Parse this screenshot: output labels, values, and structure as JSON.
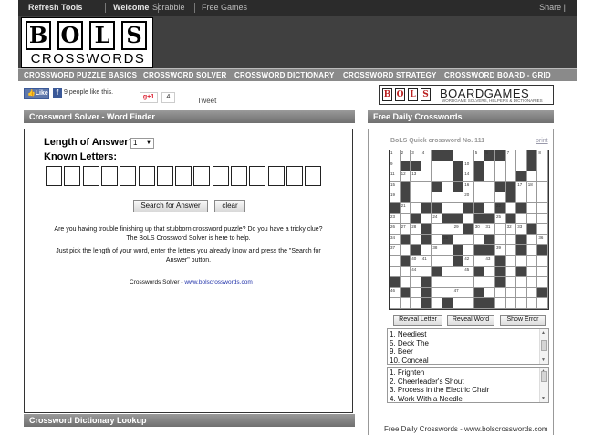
{
  "topnav": {
    "items": [
      "Refresh Tools",
      "Welcome",
      "Scrabble",
      "Free Games"
    ],
    "share": "Share |"
  },
  "logo": {
    "letters": [
      "B",
      "O",
      "L",
      "S"
    ],
    "word": "CROSSWORDS"
  },
  "menu": [
    "CROSSWORD PUZZLE BASICS",
    "CROSSWORD SOLVER",
    "CROSSWORD DICTIONARY",
    "CROSSWORD STRATEGY",
    "CROSSWORD BOARD - GRID"
  ],
  "social": {
    "like_label": "Like",
    "like_text": "9 people like this.",
    "gplus_label": "+1",
    "gplus_count": "4",
    "tweet_label": "Tweet"
  },
  "banner": {
    "letters": [
      "B",
      "O",
      "L",
      "S"
    ],
    "name": "BOARDGAMES",
    "tagline": "WORDGAME SOLVERS, HELPERS & DICTIONARIES"
  },
  "solver": {
    "header": "Crossword Solver - Word Finder",
    "length_label": "Length of Answer?",
    "length_value": "1",
    "known_label": "Known Letters:",
    "letter_box_count": 15,
    "search_button": "Search for Answer",
    "clear_button": "clear",
    "para1_line1": "Are you having trouble finishing up that stubborn crossword puzzle? Do you have a tricky clue?",
    "para1_line2": "The BoLS Crossword Solver is here to help.",
    "para2_line1": "Just pick the length of your word, enter the letters you already know and press the \"Search for",
    "para2_line2": "Answer\" button.",
    "credit_text": "Crosswords Solver - ",
    "credit_link": "www.bolscrosswords.com"
  },
  "dictionary": {
    "header": "Crossword Dictionary Lookup"
  },
  "daily": {
    "header": "Free Daily Crosswords",
    "title": "BoLS Quick crossword No. 111",
    "print": "print",
    "grid_size": 15,
    "black_cells": [
      [
        0,
        4
      ],
      [
        0,
        5
      ],
      [
        0,
        9
      ],
      [
        0,
        10
      ],
      [
        0,
        13
      ],
      [
        1,
        1
      ],
      [
        1,
        2
      ],
      [
        1,
        6
      ],
      [
        1,
        8
      ],
      [
        1,
        13
      ],
      [
        2,
        6
      ],
      [
        2,
        8
      ],
      [
        2,
        12
      ],
      [
        3,
        1
      ],
      [
        3,
        4
      ],
      [
        3,
        6
      ],
      [
        3,
        10
      ],
      [
        3,
        11
      ],
      [
        4,
        1
      ],
      [
        4,
        11
      ],
      [
        5,
        0
      ],
      [
        5,
        3
      ],
      [
        5,
        4
      ],
      [
        5,
        7
      ],
      [
        5,
        8
      ],
      [
        5,
        10
      ],
      [
        5,
        12
      ],
      [
        6,
        2
      ],
      [
        6,
        5
      ],
      [
        6,
        6
      ],
      [
        6,
        8
      ],
      [
        6,
        9
      ],
      [
        6,
        11
      ],
      [
        7,
        3
      ],
      [
        7,
        7
      ],
      [
        7,
        13
      ],
      [
        8,
        1
      ],
      [
        8,
        3
      ],
      [
        8,
        5
      ],
      [
        8,
        9
      ],
      [
        8,
        12
      ],
      [
        9,
        2
      ],
      [
        9,
        6
      ],
      [
        9,
        8
      ],
      [
        9,
        9
      ],
      [
        9,
        12
      ],
      [
        9,
        14
      ],
      [
        10,
        1
      ],
      [
        10,
        6
      ],
      [
        10,
        10
      ],
      [
        11,
        4
      ],
      [
        11,
        8
      ],
      [
        11,
        10
      ],
      [
        11,
        12
      ],
      [
        12,
        0
      ],
      [
        12,
        3
      ],
      [
        12,
        10
      ],
      [
        13,
        1
      ],
      [
        13,
        3
      ],
      [
        13,
        8
      ],
      [
        13,
        14
      ],
      [
        14,
        3
      ],
      [
        14,
        5
      ],
      [
        14,
        8
      ],
      [
        14,
        9
      ]
    ],
    "numbered_cells": [
      [
        0,
        0,
        "1"
      ],
      [
        0,
        1,
        "2"
      ],
      [
        0,
        2,
        "3"
      ],
      [
        0,
        3,
        "4"
      ],
      [
        0,
        8,
        "5"
      ],
      [
        0,
        9,
        "6"
      ],
      [
        0,
        11,
        "7"
      ],
      [
        0,
        14,
        "8"
      ],
      [
        1,
        0,
        "9"
      ],
      [
        1,
        7,
        "10"
      ],
      [
        2,
        0,
        "11"
      ],
      [
        2,
        1,
        "12"
      ],
      [
        2,
        2,
        "13"
      ],
      [
        2,
        7,
        "14"
      ],
      [
        3,
        0,
        "15"
      ],
      [
        3,
        7,
        "16"
      ],
      [
        3,
        12,
        "17"
      ],
      [
        3,
        13,
        "18"
      ],
      [
        4,
        0,
        "19"
      ],
      [
        4,
        7,
        "20"
      ],
      [
        5,
        1,
        "21"
      ],
      [
        5,
        10,
        "22"
      ],
      [
        6,
        0,
        "23"
      ],
      [
        6,
        4,
        "24"
      ],
      [
        6,
        10,
        "25"
      ],
      [
        7,
        0,
        "26"
      ],
      [
        7,
        1,
        "27"
      ],
      [
        7,
        2,
        "28"
      ],
      [
        7,
        6,
        "29"
      ],
      [
        7,
        8,
        "30"
      ],
      [
        7,
        9,
        "31"
      ],
      [
        7,
        11,
        "32"
      ],
      [
        7,
        12,
        "33"
      ],
      [
        8,
        0,
        "34"
      ],
      [
        8,
        5,
        "35"
      ],
      [
        8,
        14,
        "36"
      ],
      [
        9,
        0,
        "37"
      ],
      [
        9,
        4,
        "38"
      ],
      [
        9,
        10,
        "39"
      ],
      [
        10,
        2,
        "40"
      ],
      [
        10,
        3,
        "41"
      ],
      [
        10,
        7,
        "42"
      ],
      [
        10,
        9,
        "43"
      ],
      [
        11,
        2,
        "44"
      ],
      [
        11,
        7,
        "45"
      ],
      [
        13,
        0,
        "46"
      ],
      [
        13,
        6,
        "47"
      ]
    ],
    "buttons": [
      "Reveal Letter",
      "Reveal Word",
      "Show Error"
    ],
    "across_clues": [
      "1.  Neediest",
      "5.  Deck The ______",
      "9.  Beer",
      "10. Conceal"
    ],
    "down_clues": [
      "1.  Frighten",
      "2.  Cheerleader's Shout",
      "3.  Process in the Electric Chair",
      "4.  Work With a Needle"
    ],
    "footer": "Free Daily Crosswords - www.bolscrosswords.com"
  }
}
